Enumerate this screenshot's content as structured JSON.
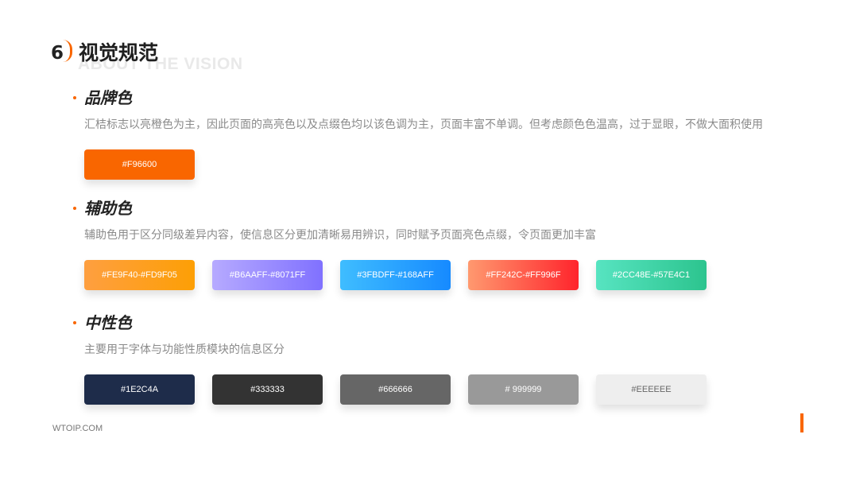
{
  "header": {
    "number": "6",
    "title": "视觉规范",
    "subtitle": "ABOUT THE VISION"
  },
  "sections": [
    {
      "title": "品牌色",
      "description": "汇桔标志以亮橙色为主，因此页面的高亮色以及点缀色均以该色调为主，页面丰富不单调。但考虑颜色色温高，过于显眼，不做大面积使用",
      "swatches": [
        {
          "label": "#F96600",
          "color": "#F96600"
        }
      ]
    },
    {
      "title": "辅助色",
      "description": "辅助色用于区分同级差异内容，使信息区分更加清晰易用辨识，同时赋予页面亮色点缀，令页面更加丰富",
      "swatches": [
        {
          "label": "#FE9F40-#FD9F05",
          "from": "#FE9F40",
          "to": "#FD9F05"
        },
        {
          "label": "#B6AAFF-#8071FF",
          "from": "#B6AAFF",
          "to": "#8071FF"
        },
        {
          "label": "#3FBDFF-#168AFF",
          "from": "#3FBDFF",
          "to": "#168AFF"
        },
        {
          "label": "#FF242C-#FF996F",
          "from": "#FF996F",
          "to": "#FF242C"
        },
        {
          "label": "#2CC48E-#57E4C1",
          "from": "#57E4C1",
          "to": "#2CC48E"
        }
      ]
    },
    {
      "title": "中性色",
      "description": "主要用于字体与功能性质模块的信息区分",
      "swatches": [
        {
          "label": "#1E2C4A",
          "color": "#1E2C4A"
        },
        {
          "label": "#333333",
          "color": "#333333"
        },
        {
          "label": "#666666",
          "color": "#666666"
        },
        {
          "label": "# 999999",
          "color": "#999999"
        },
        {
          "label": "#EEEEEE",
          "color": "#EEEEEE",
          "text_color": "#666666"
        }
      ]
    }
  ],
  "footer": {
    "site": "WTOIP.COM"
  },
  "accent_color": "#F96600"
}
